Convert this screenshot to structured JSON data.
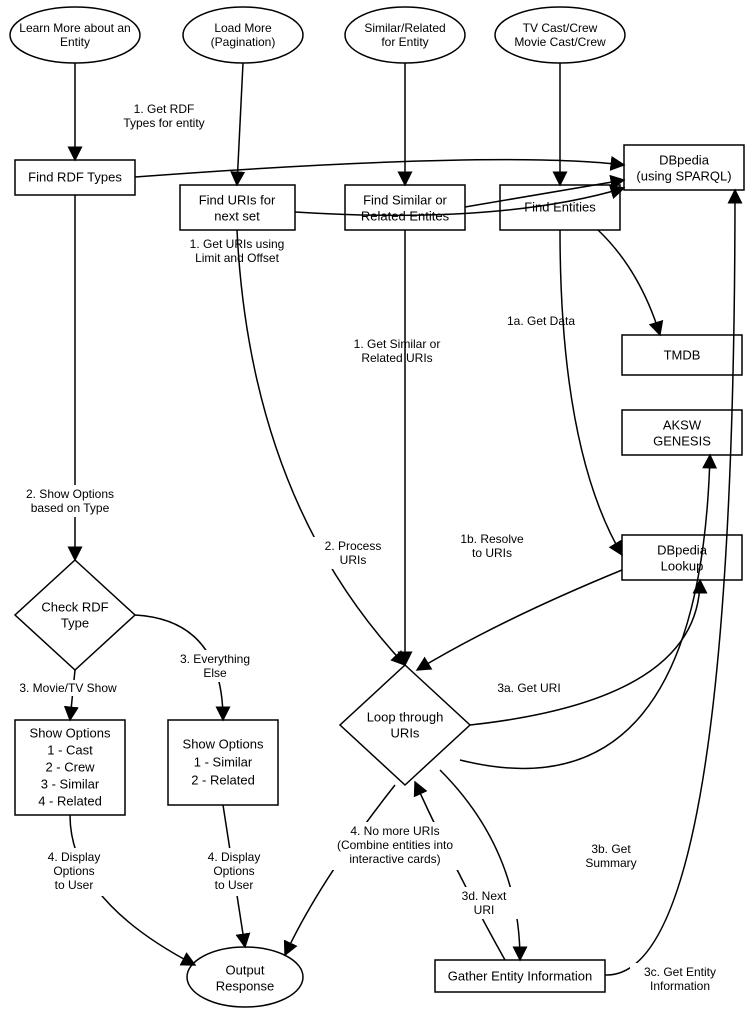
{
  "entry": {
    "learn": [
      "Learn More about an",
      "Entity"
    ],
    "load": [
      "Load More",
      "(Pagination)"
    ],
    "similar": [
      "Similar/Related",
      "for Entity"
    ],
    "cast": [
      "TV Cast/Crew",
      "Movie Cast/Crew"
    ]
  },
  "proc": {
    "findRdf": "Find RDF Types",
    "findUris": [
      "Find URIs for",
      "next set"
    ],
    "findSim": [
      "Find Similar or",
      "Related Entites"
    ],
    "findEnt": "Find Entities",
    "checkRdf": [
      "Check RDF",
      "Type"
    ],
    "optA": [
      "Show Options",
      "1 - Cast",
      "2 - Crew",
      "3 - Similar",
      "4 - Related"
    ],
    "optB": [
      "Show Options",
      "1 - Similar",
      "2 - Related"
    ],
    "loop": [
      "Loop through",
      "URIs"
    ],
    "gather": "Gather Entity Information",
    "out": [
      "Output",
      "Response"
    ]
  },
  "ds": {
    "dbpedia": [
      "DBpedia",
      "(using SPARQL)"
    ],
    "tmdb": "TMDB",
    "aksw": [
      "AKSW",
      "GENESIS"
    ],
    "lookup": [
      "DBpedia",
      "Lookup"
    ]
  },
  "edge": {
    "e1": [
      "1. Get RDF",
      "Types for entity"
    ],
    "e2": [
      "1. Get URIs using",
      "Limit and Offset"
    ],
    "e3": [
      "1. Get Similar or",
      "Related URIs"
    ],
    "e1a": "1a. Get Data",
    "e1b": [
      "1b. Resolve",
      "to URIs"
    ],
    "eShow": [
      "2. Show Options",
      "based on Type"
    ],
    "eProc": [
      "2. Process",
      "URIs"
    ],
    "eMovie": "3. Movie/TV Show",
    "eElse": [
      "3. Everything",
      "Else"
    ],
    "e3a": "3a. Get URI",
    "e3b": [
      "3b. Get",
      "Summary"
    ],
    "e3c": [
      "3c. Get Entity",
      "Information"
    ],
    "e3d": [
      "3d. Next",
      "URI"
    ],
    "e4a": [
      "4. Display",
      "Options",
      "to User"
    ],
    "e4b": [
      "4. Display",
      "Options",
      "to User"
    ],
    "eNoMore": [
      "4. No more URIs",
      "(Combine entities into",
      "interactive cards)"
    ]
  }
}
